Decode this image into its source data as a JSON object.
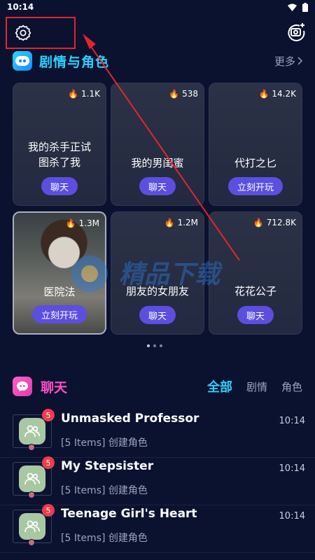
{
  "status": {
    "time": "10:14"
  },
  "featured": {
    "title": "剧情与角色",
    "more": "更多",
    "cards": [
      {
        "name": "我的杀手正试\n图杀了我",
        "hot": "1.1K",
        "button": "聊天"
      },
      {
        "name": "我的男闺蜜",
        "hot": "538",
        "button": "聊天"
      },
      {
        "name": "代打之匕",
        "hot": "14.2K",
        "button": "立刻开玩"
      },
      {
        "name": "医院法",
        "hot": "1.3M",
        "button": "立刻开玩"
      },
      {
        "name": "朋友的女朋友",
        "hot": "1.2M",
        "button": "聊天"
      },
      {
        "name": "花花公子",
        "hot": "712.8K",
        "button": "聊天"
      }
    ]
  },
  "watermark": "精品下载",
  "chats": {
    "title": "聊天",
    "tabs": [
      "全部",
      "剧情",
      "角色"
    ],
    "items": [
      {
        "name": "Unmasked Professor",
        "preview": "[5 Items] 创建角色",
        "time": "10:14",
        "badge": "5"
      },
      {
        "name": "My Stepsister",
        "preview": "[5 Items] 创建角色",
        "time": "10:14",
        "badge": "5"
      },
      {
        "name": "Teenage Girl's Heart",
        "preview": "[5 Items] 创建角色",
        "time": "10:14",
        "badge": "5"
      }
    ]
  }
}
